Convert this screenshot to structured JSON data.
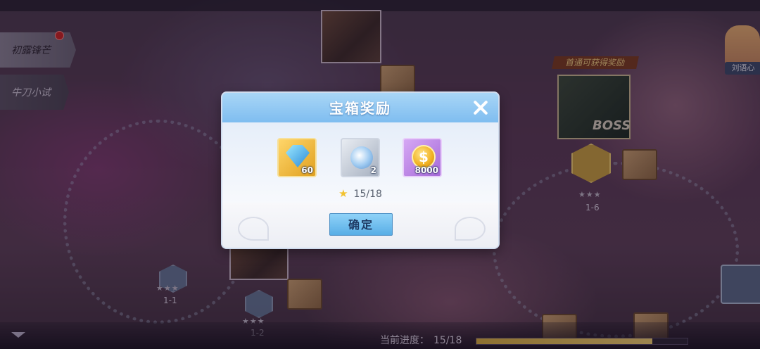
{
  "sidebar": {
    "tabs": [
      {
        "label": "初露锋芒"
      },
      {
        "label": "牛刀小试"
      }
    ]
  },
  "map": {
    "boss_banner": "首通可获得奖励",
    "boss_label": "BOSS",
    "npc_name": "刘语心",
    "levels": [
      {
        "label": "1-1",
        "stars": "★★★"
      },
      {
        "label": "1-2",
        "stars": "★★★"
      },
      {
        "label": "1-6",
        "stars": "★★★"
      }
    ]
  },
  "progress": {
    "label": "当前进度：",
    "value": "15/18",
    "fraction": 0.833
  },
  "modal": {
    "title": "宝箱奖励",
    "rewards": [
      {
        "name": "diamond",
        "icon": "diamond-icon",
        "quantity": "60"
      },
      {
        "name": "orb",
        "icon": "crystal-orb-icon",
        "quantity": "2"
      },
      {
        "name": "gold-coin",
        "icon": "gold-coin-icon",
        "quantity": "8000",
        "symbol": "$"
      }
    ],
    "star_progress": "15/18",
    "confirm_label": "确定"
  },
  "colors": {
    "modal_header": "#7fbdf0",
    "confirm_button": "#58aee6",
    "star": "#f2c230"
  }
}
